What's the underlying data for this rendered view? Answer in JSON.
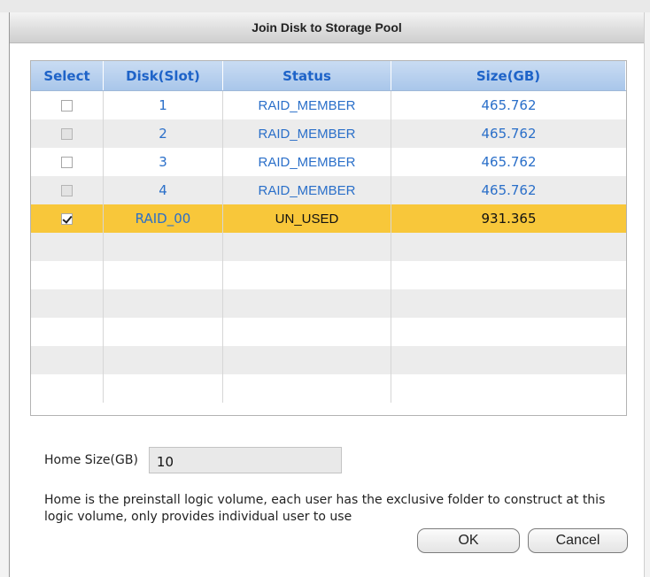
{
  "dialog": {
    "title": "Join Disk to Storage Pool"
  },
  "table": {
    "headers": {
      "select": "Select",
      "disk": "Disk(Slot)",
      "status": "Status",
      "size": "Size(GB)"
    },
    "rows": [
      {
        "disk": "1",
        "status": "RAID_MEMBER",
        "size": "465.762",
        "checked": false,
        "enabled": true
      },
      {
        "disk": "2",
        "status": "RAID_MEMBER",
        "size": "465.762",
        "checked": false,
        "enabled": false
      },
      {
        "disk": "3",
        "status": "RAID_MEMBER",
        "size": "465.762",
        "checked": false,
        "enabled": true
      },
      {
        "disk": "4",
        "status": "RAID_MEMBER",
        "size": "465.762",
        "checked": false,
        "enabled": false
      },
      {
        "disk": "RAID_00",
        "status": "UN_USED",
        "size": "931.365",
        "checked": true,
        "enabled": true,
        "selected": true
      }
    ]
  },
  "form": {
    "home_size_label": "Home Size(GB)",
    "home_size_value": "10",
    "description": "Home is the preinstall logic volume, each user has the exclusive folder to construct at this logic volume, only provides individual user to use"
  },
  "buttons": {
    "ok_label": "OK",
    "cancel_label": "Cancel"
  },
  "colors": {
    "header_text": "#1e63c8",
    "cell_text": "#2a6fc9",
    "selected_row": "#f8c73a",
    "alt_row": "#ececec"
  }
}
